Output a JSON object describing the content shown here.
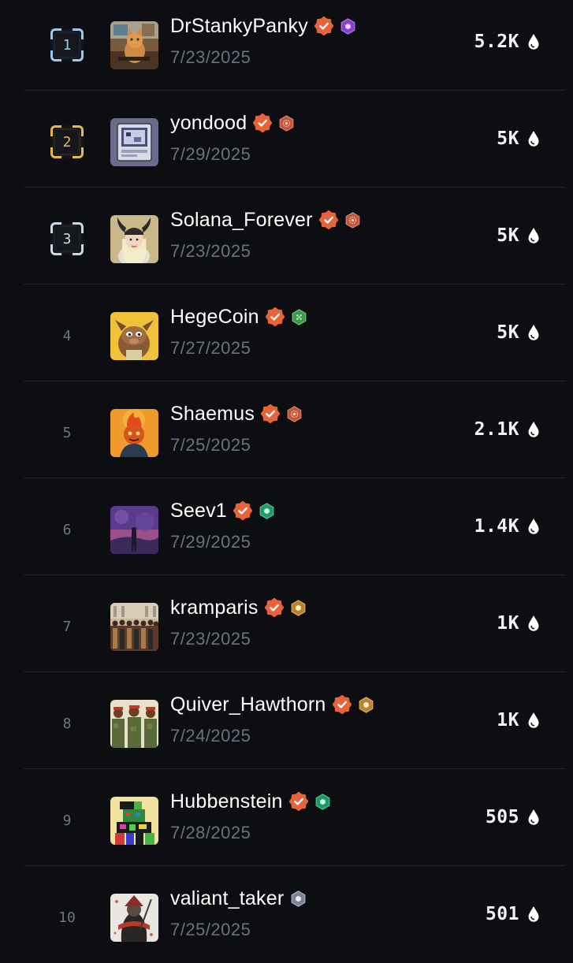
{
  "colors": {
    "background": "#0d0e12",
    "verified": "#e8623a",
    "rank1": "#9ec7e8",
    "rank2": "#e6b84a",
    "rank3": "#cfd6e6"
  },
  "rows": [
    {
      "rank": "1",
      "name": "DrStankyPanky",
      "date": "7/23/2025",
      "score": "5.2K",
      "verified": true,
      "tier": "purple",
      "avatar": "cat"
    },
    {
      "rank": "2",
      "name": "yondood",
      "date": "7/29/2025",
      "score": "5K",
      "verified": true,
      "tier": "bronze-gear",
      "avatar": "card"
    },
    {
      "rank": "3",
      "name": "Solana_Forever",
      "date": "7/23/2025",
      "score": "5K",
      "verified": true,
      "tier": "bronze-gear",
      "avatar": "viking"
    },
    {
      "rank": "4",
      "name": "HegeCoin",
      "date": "7/27/2025",
      "score": "5K",
      "verified": true,
      "tier": "green-dice",
      "avatar": "hedgehog"
    },
    {
      "rank": "5",
      "name": "Shaemus",
      "date": "7/25/2025",
      "score": "2.1K",
      "verified": true,
      "tier": "bronze-gear",
      "avatar": "flame"
    },
    {
      "rank": "6",
      "name": "Seev1",
      "date": "7/29/2025",
      "score": "1.4K",
      "verified": true,
      "tier": "green",
      "avatar": "purple-sky"
    },
    {
      "rank": "7",
      "name": "kramparis",
      "date": "7/23/2025",
      "score": "1K",
      "verified": true,
      "tier": "gold",
      "avatar": "crowd"
    },
    {
      "rank": "8",
      "name": "Quiver_Hawthorn",
      "date": "7/24/2025",
      "score": "1K",
      "verified": true,
      "tier": "gold",
      "avatar": "soldiers"
    },
    {
      "rank": "9",
      "name": "Hubbenstein",
      "date": "7/28/2025",
      "score": "505",
      "verified": true,
      "tier": "green",
      "avatar": "pixel"
    },
    {
      "rank": "10",
      "name": "valiant_taker",
      "date": "7/25/2025",
      "score": "501",
      "verified": false,
      "tier": "silver",
      "avatar": "samurai"
    }
  ]
}
